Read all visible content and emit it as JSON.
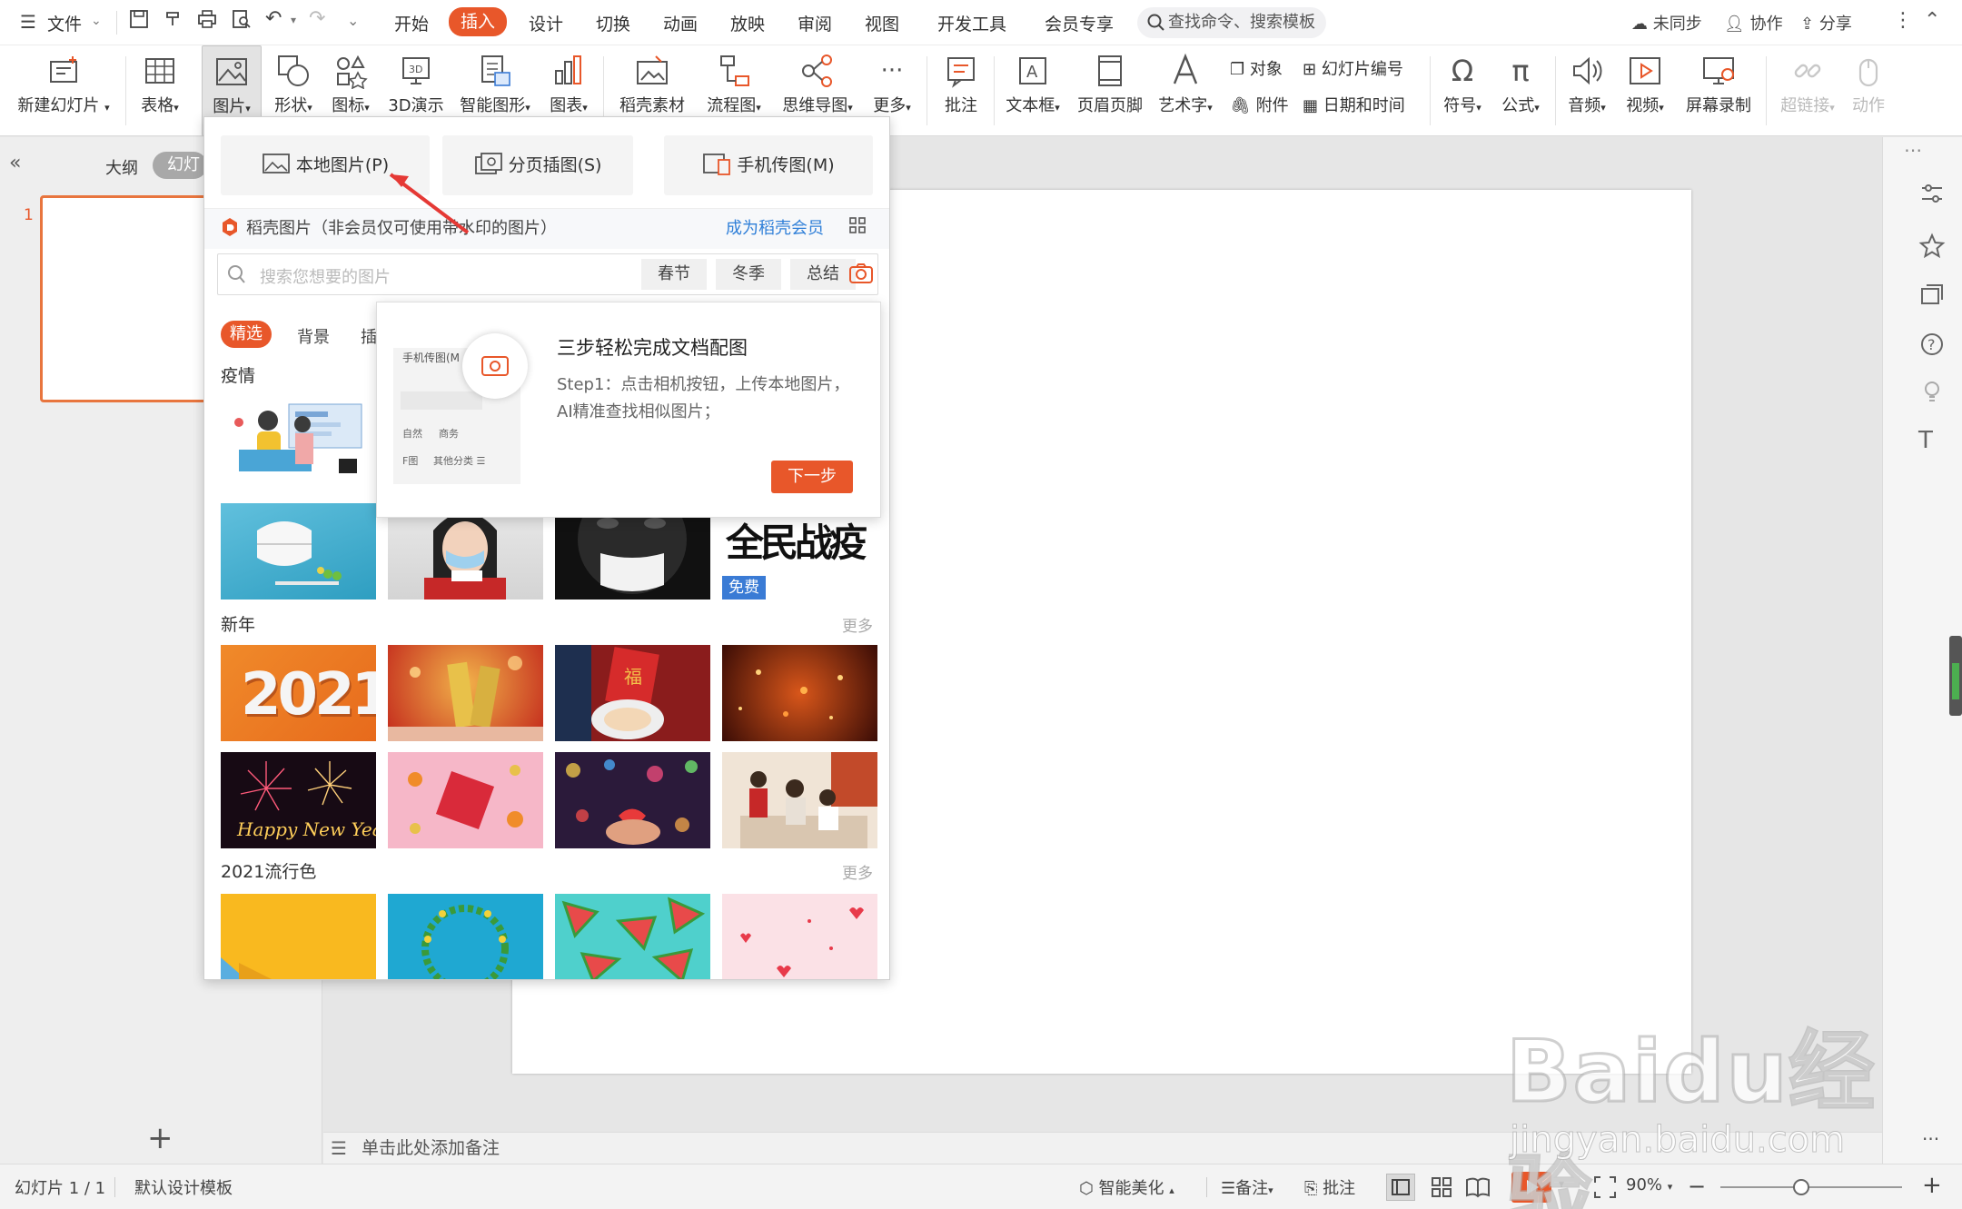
{
  "menu": {
    "file": "文件",
    "tabs": [
      "开始",
      "插入",
      "设计",
      "切换",
      "动画",
      "放映",
      "审阅",
      "视图",
      "开发工具",
      "会员专享"
    ],
    "active_tab": "插入",
    "search_placeholder": "查找命令、搜索模板",
    "sync": "未同步",
    "collab": "协作",
    "share": "分享"
  },
  "ribbon": {
    "new_slide": "新建幻灯片",
    "table": "表格",
    "picture": "图片",
    "shape": "形状",
    "icon": "图标",
    "threed": "3D演示",
    "smartart": "智能图形",
    "chart": "图表",
    "daoke": "稻壳素材",
    "flowchart": "流程图",
    "mindmap": "思维导图",
    "more": "更多",
    "comment": "批注",
    "textbox": "文本框",
    "header_footer": "页眉页脚",
    "wordart": "艺术字",
    "object": "对象",
    "slide_number": "幻灯片编号",
    "attachment": "附件",
    "datetime": "日期和时间",
    "symbol": "符号",
    "formula": "公式",
    "audio": "音频",
    "video": "视频",
    "screen_record": "屏幕录制",
    "hyperlink": "超链接",
    "action": "动作"
  },
  "left_panel": {
    "outline_tab": "大纲",
    "slides_tab": "幻灯",
    "slide_number": "1",
    "add": "+"
  },
  "popup": {
    "local_picture": "本地图片(P)",
    "paged_insert": "分页插图(S)",
    "phone_picture": "手机传图(M)",
    "daoke_title": "稻壳图片（非会员仅可使用带水印的图片）",
    "become_member": "成为稻壳会员",
    "search_placeholder": "搜索您想要的图片",
    "search_tags": [
      "春节",
      "冬季",
      "总结"
    ],
    "filter_tabs": [
      "精选",
      "背景",
      "插"
    ],
    "categories": [
      {
        "name": "疫情",
        "more": ""
      },
      {
        "name": "新年",
        "more": "更多"
      },
      {
        "name": "2021流行色",
        "more": "更多"
      }
    ],
    "free_badge": "免费",
    "year_text": "2021",
    "calligraphy": "全民战疫"
  },
  "tip": {
    "title": "三步轻松完成文档配图",
    "body_line1": "Step1：点击相机按钮，上传本地图片，",
    "body_line2": "AI精准查找相似图片；",
    "next": "下一步",
    "thumb_title": "手机传图(M",
    "thumb_tags": [
      "自然",
      "商务"
    ],
    "thumb_tags2": [
      "F图",
      "其他分类 ☰"
    ]
  },
  "notes": {
    "placeholder": "单击此处添加备注"
  },
  "status": {
    "slide_count": "幻灯片 1 / 1",
    "template": "默认设计模板",
    "beautify": "智能美化",
    "notes": "备注",
    "comments": "批注",
    "zoom": "90%"
  },
  "watermark": {
    "brand": "Baidu经验",
    "url": "jingyan.baidu.com"
  },
  "colors": {
    "accent": "#e8572a",
    "link": "#2f7fd8"
  }
}
